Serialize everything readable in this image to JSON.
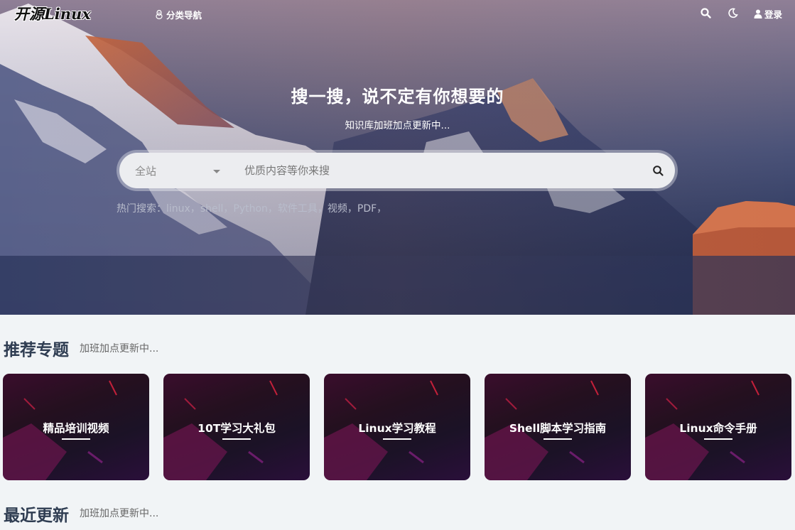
{
  "header": {
    "logo": "开源Linux",
    "nav_category": "分类导航",
    "login": "登录"
  },
  "hero": {
    "title": "搜一搜，说不定有你想要的",
    "subtitle": "知识库加班加点更新中...",
    "search": {
      "scope": "全站",
      "placeholder": "优质内容等你来搜"
    },
    "hot_label": "热门搜索：",
    "hot_keywords": [
      "linux，",
      "shell，",
      "Python，",
      "软件工具，",
      "视频，",
      "PDF，"
    ]
  },
  "recommended": {
    "title": "推荐专题",
    "subtitle": "加班加点更新中...",
    "cards": [
      "精品培训视频",
      "10T学习大礼包",
      "Linux学习教程",
      "Shell脚本学习指南",
      "Linux命令手册"
    ]
  },
  "recent": {
    "title": "最近更新",
    "subtitle": "加班加点更新中..."
  },
  "icons": [
    "linux-icon",
    "search-icon",
    "moon-icon",
    "user-icon",
    "caret-down-icon"
  ],
  "colors": {
    "section_title": "#2f3d52",
    "hot_search_text": "#b8bccb",
    "page_background": "#f1f4f6"
  }
}
